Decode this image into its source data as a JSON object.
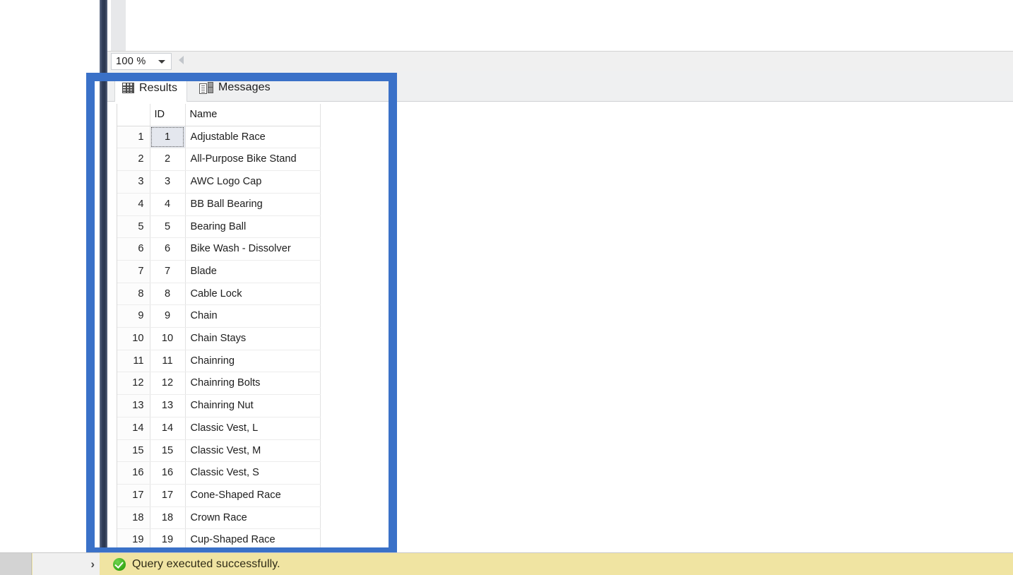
{
  "editor": {
    "zoom_level": "100 %",
    "zoom_dropdown_icon": "chevron-down-icon",
    "scroll_left_icon": "triangle-left-icon"
  },
  "results_pane": {
    "tabs": [
      {
        "label": "Results",
        "icon": "grid-icon",
        "active": true
      },
      {
        "label": "Messages",
        "icon": "messages-icon",
        "active": false
      }
    ],
    "grid": {
      "columns": [
        "",
        "ID",
        "Name"
      ],
      "selected_cell": {
        "row": 1,
        "column": "ID"
      },
      "rows": [
        {
          "rn": "1",
          "id": "1",
          "name": "Adjustable Race"
        },
        {
          "rn": "2",
          "id": "2",
          "name": "All-Purpose Bike Stand"
        },
        {
          "rn": "3",
          "id": "3",
          "name": "AWC Logo Cap"
        },
        {
          "rn": "4",
          "id": "4",
          "name": "BB Ball Bearing"
        },
        {
          "rn": "5",
          "id": "5",
          "name": "Bearing Ball"
        },
        {
          "rn": "6",
          "id": "6",
          "name": "Bike Wash - Dissolver"
        },
        {
          "rn": "7",
          "id": "7",
          "name": "Blade"
        },
        {
          "rn": "8",
          "id": "8",
          "name": "Cable Lock"
        },
        {
          "rn": "9",
          "id": "9",
          "name": "Chain"
        },
        {
          "rn": "10",
          "id": "10",
          "name": "Chain Stays"
        },
        {
          "rn": "11",
          "id": "11",
          "name": "Chainring"
        },
        {
          "rn": "12",
          "id": "12",
          "name": "Chainring Bolts"
        },
        {
          "rn": "13",
          "id": "13",
          "name": "Chainring Nut"
        },
        {
          "rn": "14",
          "id": "14",
          "name": "Classic Vest, L"
        },
        {
          "rn": "15",
          "id": "15",
          "name": "Classic Vest, M"
        },
        {
          "rn": "16",
          "id": "16",
          "name": "Classic Vest, S"
        },
        {
          "rn": "17",
          "id": "17",
          "name": "Cone-Shaped Race"
        },
        {
          "rn": "18",
          "id": "18",
          "name": "Crown Race"
        },
        {
          "rn": "19",
          "id": "19",
          "name": "Cup-Shaped Race"
        }
      ]
    }
  },
  "annotation": {
    "shape": "rectangle-highlight",
    "color": "#3a71c8"
  },
  "statusbar": {
    "expand_icon": "chevron-right-icon",
    "status_icon": "success-check-icon",
    "message": "Query executed successfully.",
    "background_color": "#f0e4a2"
  }
}
